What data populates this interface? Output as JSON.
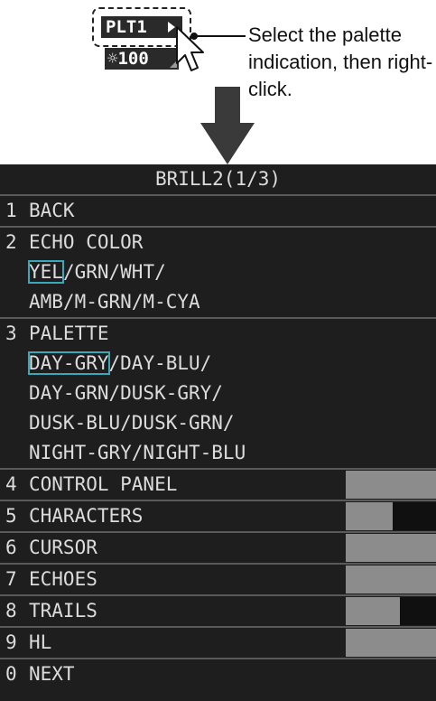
{
  "callout": {
    "palette_chip": "PLT1",
    "brill_chip": "☼100",
    "instruction": "Select the palette indication, then right-click."
  },
  "menu": {
    "title": "BRILL2(1/3)",
    "items": [
      {
        "num": "1",
        "label": "BACK"
      },
      {
        "num": "2",
        "label": "ECHO COLOR",
        "options_line1_selected": "YEL",
        "options_line1_rest": "/GRN/WHT/",
        "options_line2": "AMB/M-GRN/M-CYA"
      },
      {
        "num": "3",
        "label": "PALETTE",
        "options_line1_selected": "DAY-GRY",
        "options_line1_rest": "/DAY-BLU/",
        "options_line2": "DAY-GRN/DUSK-GRY/",
        "options_line3": "DUSK-BLU/DUSK-GRN/",
        "options_line4": "NIGHT-GRY/NIGHT-BLU"
      },
      {
        "num": "4",
        "label": "CONTROL PANEL",
        "level": 1.0
      },
      {
        "num": "5",
        "label": "CHARACTERS",
        "level": 0.52
      },
      {
        "num": "6",
        "label": "CURSOR",
        "level": 1.0
      },
      {
        "num": "7",
        "label": "ECHOES",
        "level": 1.0
      },
      {
        "num": "8",
        "label": "TRAILS",
        "level": 0.6
      },
      {
        "num": "9",
        "label": "HL",
        "level": 1.0
      },
      {
        "num": "0",
        "label": "NEXT"
      }
    ]
  }
}
